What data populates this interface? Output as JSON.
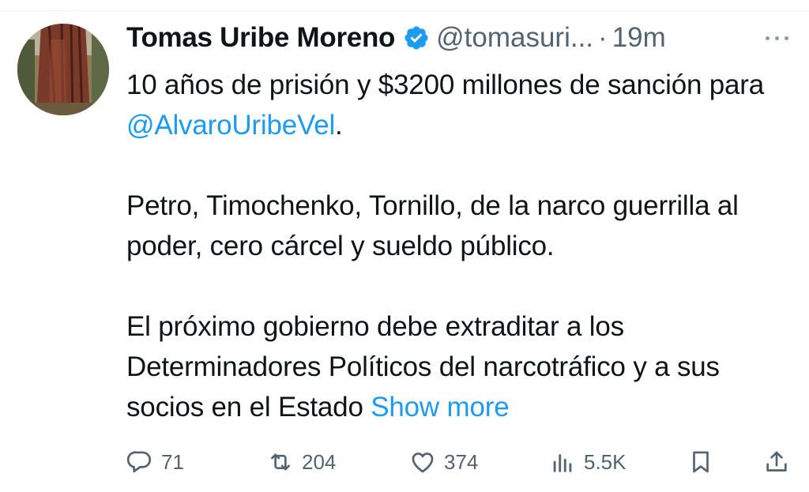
{
  "tweet": {
    "author": {
      "display_name": "Tomas Uribe Moreno",
      "handle": "@tomasuri...",
      "verified": true
    },
    "separator": "·",
    "time": "19m",
    "body": {
      "line1_prefix": "10 años de prisión y $3200 millones de sanción para ",
      "mention": "@AlvaroUribeVel",
      "line1_suffix": ".",
      "paragraph2": "Petro, Timochenko, Tornillo, de la narco guerrilla al poder, cero cárcel y sueldo público.",
      "paragraph3": "El próximo gobierno debe extraditar a los Determinadores Políticos del narcotráfico y a sus socios en el Estado ",
      "show_more": "Show more"
    },
    "actions": {
      "replies": "71",
      "retweets": "204",
      "likes": "374",
      "views": "5.5K"
    }
  },
  "icons": {
    "verified": "verified-badge-icon",
    "more": "more-icon",
    "reply": "reply-icon",
    "retweet": "retweet-icon",
    "like": "heart-icon",
    "views": "views-icon",
    "bookmark": "bookmark-icon",
    "share": "share-icon"
  },
  "colors": {
    "text": "#0f1419",
    "secondary": "#536471",
    "link": "#1d9bf0"
  }
}
